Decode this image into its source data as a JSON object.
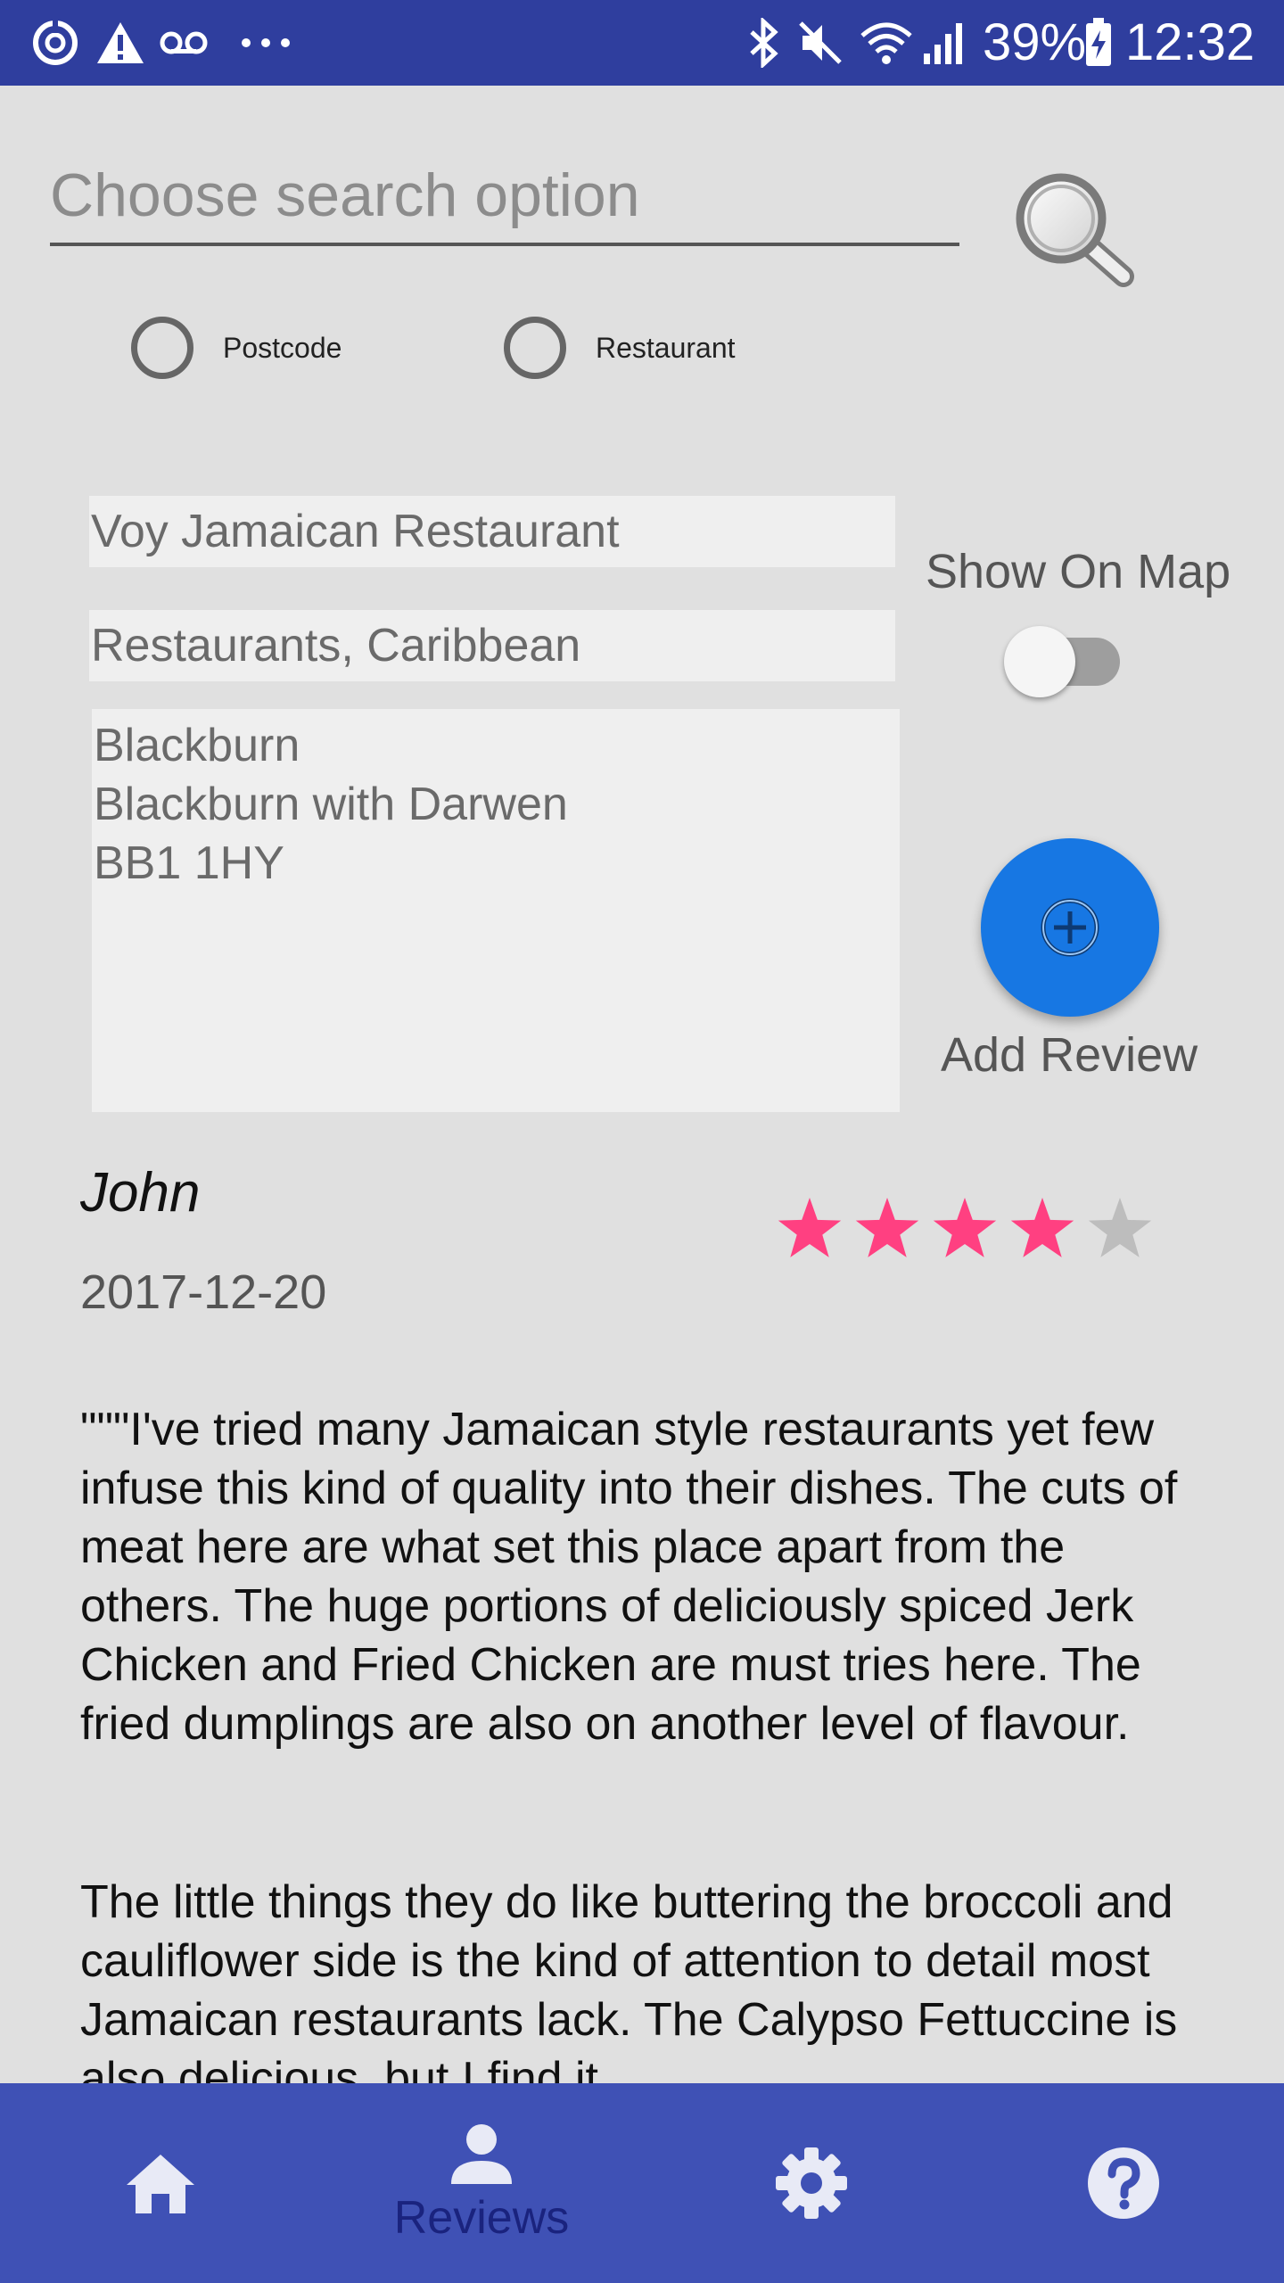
{
  "status_bar": {
    "battery_percent": "39%",
    "time": "12:32",
    "icons": [
      "sync-icon",
      "warning-icon",
      "voicemail-icon",
      "more-icon",
      "bluetooth-icon",
      "mute-icon",
      "wifi-icon",
      "signal-icon",
      "battery-icon"
    ]
  },
  "search": {
    "placeholder": "Choose search option",
    "options": [
      {
        "label": "Postcode",
        "selected": false
      },
      {
        "label": "Restaurant",
        "selected": false
      }
    ]
  },
  "restaurant": {
    "name": "Voy Jamaican  Restaurant",
    "category": "Restaurants, Caribbean",
    "address_line1": "Blackburn",
    "address_line2": "Blackburn with Darwen",
    "address_line3": "BB1 1HY"
  },
  "map_toggle": {
    "label": "Show On Map",
    "on": false
  },
  "add_review": {
    "label": "Add Review"
  },
  "review": {
    "author": "John",
    "date": "2017-12-20",
    "rating": 4,
    "max_rating": 5,
    "paragraph1": "\"\"\"I've tried many Jamaican style restaurants yet few infuse this kind of quality into their dishes. The cuts of meat here are what set this place apart from the others. The huge portions of deliciously spiced Jerk Chicken and Fried Chicken are must tries here. The fried dumplings are also on another level of flavour.",
    "paragraph2": "The little things they do like buttering the broccoli and cauliflower side is the kind of attention to detail most Jamaican restaurants lack. The Calypso Fettuccine is also delicious, but I find it"
  },
  "bottom_nav": {
    "items": [
      {
        "name": "home",
        "label": ""
      },
      {
        "name": "reviews",
        "label": "Reviews",
        "active": true
      },
      {
        "name": "settings",
        "label": ""
      },
      {
        "name": "help",
        "label": ""
      }
    ]
  },
  "colors": {
    "status_bar": "#2f3e9e",
    "bottom_nav": "#3f51b5",
    "fab": "#1777e3",
    "star_filled": "#ff4081",
    "star_empty": "#bdbdbd"
  }
}
